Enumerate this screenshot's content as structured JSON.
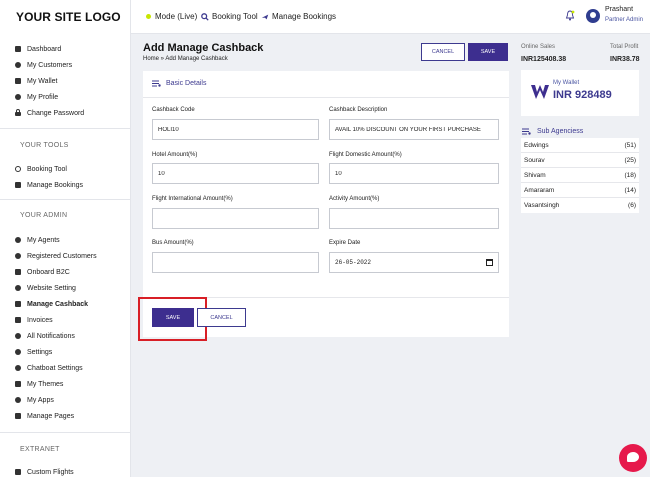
{
  "sidebar": {
    "logo": "YOUR SITE LOGO",
    "main_items": [
      {
        "label": "Dashboard",
        "icon": "dashboard-icon"
      },
      {
        "label": "My Customers",
        "icon": "users-icon"
      },
      {
        "label": "My Wallet",
        "icon": "wallet-icon"
      },
      {
        "label": "My Profile",
        "icon": "user-icon"
      },
      {
        "label": "Change Password",
        "icon": "lock-icon"
      }
    ],
    "tools_title": "YOUR TOOLS",
    "tools_items": [
      {
        "label": "Booking Tool",
        "icon": "search-icon"
      },
      {
        "label": "Manage Bookings",
        "icon": "plane-icon"
      }
    ],
    "admin_title": "YOUR ADMIN",
    "admin_items": [
      {
        "label": "My Agents",
        "icon": "agents-icon"
      },
      {
        "label": "Registered Customers",
        "icon": "registered-users-icon"
      },
      {
        "label": "Onboard B2C",
        "icon": "onboard-icon"
      },
      {
        "label": "Website Setting",
        "icon": "settings-cog-icon"
      },
      {
        "label": "Manage Cashback",
        "icon": "tag-icon"
      },
      {
        "label": "Invoices",
        "icon": "invoice-icon"
      },
      {
        "label": "All Notifications",
        "icon": "bell-icon"
      },
      {
        "label": "Settings",
        "icon": "gear-icon"
      },
      {
        "label": "Chatboat Settings",
        "icon": "chat-icon"
      },
      {
        "label": "My Themes",
        "icon": "palette-icon"
      },
      {
        "label": "My Apps",
        "icon": "rocket-icon"
      },
      {
        "label": "Manage Pages",
        "icon": "pages-icon"
      }
    ],
    "extranet_title": "EXTRANET",
    "extranet_items": [
      {
        "label": "Custom Flights",
        "icon": "bed-icon"
      }
    ]
  },
  "topbar": {
    "mode": "Mode (Live)",
    "booking_tool": "Booking Tool",
    "manage_bookings": "Manage Bookings",
    "user_name": "Prashant",
    "user_role": "Partner Admin",
    "live_color": "#c8e600"
  },
  "page": {
    "title": "Add Manage Cashback",
    "breadcrumb": "Home » Add Manage Cashback",
    "cancel_label": "CANCEL",
    "save_label": "SAVE"
  },
  "form": {
    "section_title": "Basic Details",
    "cashback_code_label": "Cashback Code",
    "cashback_code_value": "HOLI10",
    "cashback_desc_label": "Cashback Description",
    "cashback_desc_value": "AVAIL 10% DISCOUNT ON YOUR FIRST PURCHASE",
    "hotel_amount_label": "Hotel Amount(%)",
    "hotel_amount_value": "10",
    "flight_domestic_label": "Flight Domestic Amount(%)",
    "flight_domestic_value": "10",
    "flight_intl_label": "Flight International Amount(%)",
    "flight_intl_value": "",
    "activity_label": "Activity Amount(%)",
    "activity_value": "",
    "bus_label": "Bus Amount(%)",
    "bus_value": "",
    "expire_label": "Expire Date",
    "expire_value": "26-05-2022",
    "save_label": "SAVE",
    "cancel_label": "CANCEL"
  },
  "right_panel": {
    "online_sales_label": "Online Sales",
    "online_sales_value": "INR125408.38",
    "total_profit_label": "Total Profit",
    "total_profit_value": "INR38.78",
    "wallet_label": "My Wallet",
    "wallet_amount": "INR 928489",
    "sub_agencies_title": "Sub Agenciess",
    "sub_agencies": [
      {
        "name": "Edwings",
        "count": "(51)"
      },
      {
        "name": "Sourav",
        "count": "(25)"
      },
      {
        "name": "Shivam",
        "count": "(18)"
      },
      {
        "name": "Amararam",
        "count": "(14)"
      },
      {
        "name": "Vasantsingh",
        "count": "(6)"
      }
    ]
  },
  "colors": {
    "brand": "#3d2e8f",
    "highlight": "#d81f26",
    "chat": "#e6194b"
  }
}
